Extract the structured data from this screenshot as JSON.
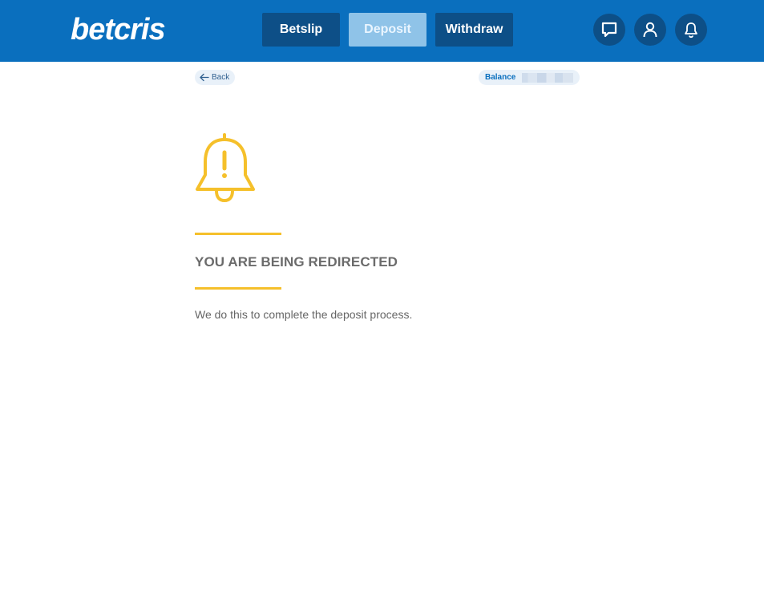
{
  "header": {
    "logo_text": "betcris",
    "nav": {
      "betslip": "Betslip",
      "deposit": "Deposit",
      "withdraw": "Withdraw"
    },
    "icons": [
      "chat-icon",
      "user-icon",
      "bell-icon"
    ]
  },
  "toolbar": {
    "back_label": "Back",
    "balance_label": "Balance"
  },
  "main": {
    "title": "YOU ARE BEING REDIRECTED",
    "subtitle": "We do this to complete the deposit process."
  },
  "colors": {
    "brand_blue": "#0a6fbe",
    "dark_blue": "#0d4f87",
    "accent_yellow": "#f5c02b"
  }
}
